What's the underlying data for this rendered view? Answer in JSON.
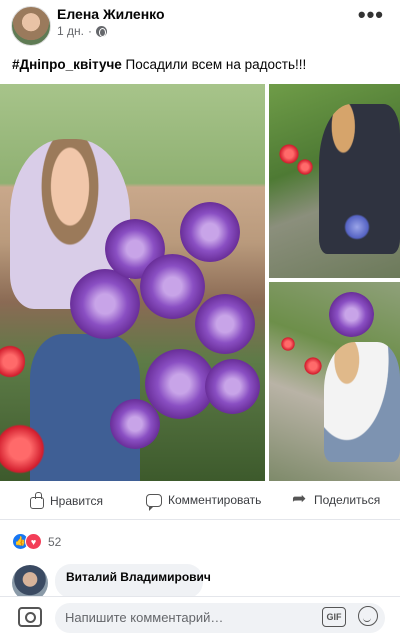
{
  "post": {
    "author": "Елена Жиленко",
    "time": "1 дн.",
    "separator": "·",
    "more": "•••",
    "caption_hashtag": "#Дніпро_квітуче",
    "caption_text": " Посадили всем на радость!!!"
  },
  "actions": {
    "like": "Нравится",
    "comment": "Комментировать",
    "share": "Поделиться"
  },
  "reactions": {
    "count": "52",
    "icons": [
      "like-icon",
      "love-icon"
    ]
  },
  "comment": {
    "author": "Виталий Владимирович"
  },
  "composer": {
    "placeholder": "Напишите комментарий…",
    "gif_label": "GIF"
  },
  "colors": {
    "like_blue": "#1877f2",
    "love_red": "#f33e58",
    "bubble_gray": "#f0f2f5",
    "secondary_text": "#65676b"
  }
}
